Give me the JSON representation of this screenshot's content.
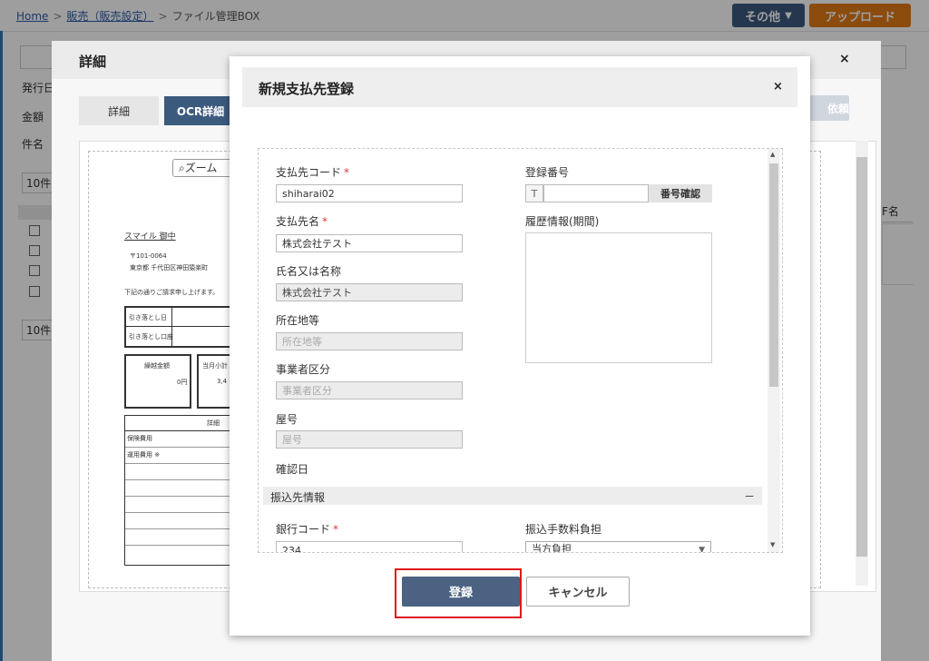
{
  "breadcrumb": {
    "home": "Home",
    "sales": "販売（販売設定）",
    "current": "ファイル管理BOX"
  },
  "toolbar": {
    "other_label": "その他",
    "upload_label": "アップロード"
  },
  "page": {
    "issue_label": "発行日",
    "amount_label": "金額",
    "subject_label": "件名",
    "per_page_top": "10件",
    "per_page_bottom": "10件",
    "name_col": "F名"
  },
  "detail": {
    "title": "詳細",
    "close": "×",
    "tabs": [
      "詳細",
      "OCR詳細"
    ],
    "request_btn": "依頼",
    "zoom_label": "ズーム"
  },
  "invoice": {
    "recipient": "スマイル 御中",
    "postal": "〒101-0064",
    "address": "東京都 千代田区神田猿楽町",
    "note": "下記の通りご請求申し上げます。",
    "row1": "引き落とし日",
    "row2": "引き落とし口座",
    "prev_amount_label": "繰越金額",
    "prev_amount_value": "0円",
    "current_label": "当月小計",
    "current_value": "3,4",
    "detail_header": "詳細",
    "line1": "保険費用",
    "line2": "運用費用 ※"
  },
  "modal": {
    "title": "新規支払先登録",
    "close": "×",
    "fields": {
      "payee_code_label": "支払先コード",
      "payee_code_value": "shiharai02",
      "payee_name_label": "支払先名",
      "payee_name_value": "株式会社テスト",
      "legal_name_label": "氏名又は名称",
      "legal_name_value": "株式会社テスト",
      "address_label": "所在地等",
      "address_placeholder": "所在地等",
      "biz_type_label": "事業者区分",
      "biz_type_placeholder": "事業者区分",
      "trade_name_label": "屋号",
      "trade_name_placeholder": "屋号",
      "confirm_date_label": "確認日",
      "reg_no_label": "登録番号",
      "reg_no_prefix": "T",
      "reg_no_check_btn": "番号確認",
      "history_label": "履歴情報(期間)"
    },
    "required_mark": "*",
    "bank_section": {
      "label": "振込先情報",
      "toggle": "－",
      "bank_code_label": "銀行コード",
      "bank_code_value": "234",
      "fee_label": "振込手数料負担",
      "fee_value": "当方負担"
    },
    "register_label": "登録",
    "cancel_label": "キャンセル"
  }
}
